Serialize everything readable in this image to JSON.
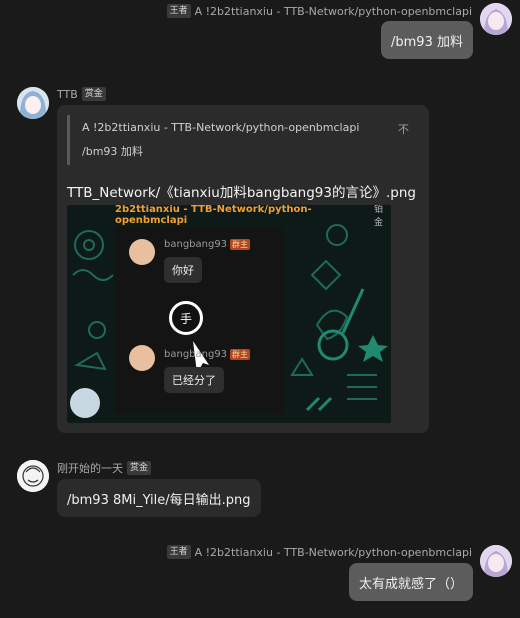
{
  "messages": [
    {
      "side": "right",
      "role": "王者",
      "sender": "A !2b2ttianxiu - TTB-Network/python-openbmclapi",
      "text": "/bm93 加料"
    },
    {
      "side": "left",
      "sender": "TTB",
      "role": "赏金",
      "quote": {
        "line1": "A !2b2ttianxiu - TTB-Network/python-openbmclapi",
        "line2": "/bm93 加料",
        "close": "不"
      },
      "filename": "TTB_Network/《tianxiu加料bangbang93的言论》.png",
      "image": {
        "header": "2b2ttianxiu - TTB-Network/python-openbmclapi",
        "header_badge": "铂金",
        "rows": [
          {
            "name": "bangbang93",
            "badge": "群主",
            "text": "你好"
          },
          {
            "name": "bangbang93",
            "badge": "群主",
            "text": "已经分了"
          }
        ],
        "hand": "手"
      }
    },
    {
      "side": "left",
      "sender": "刚开始的一天",
      "role": "赏金",
      "text": "/bm93 8Mi_Yile/每日输出.png"
    },
    {
      "side": "right",
      "role": "王者",
      "sender": "A !2b2ttianxiu - TTB-Network/python-openbmclapi",
      "text": "太有成就感了（）"
    }
  ]
}
